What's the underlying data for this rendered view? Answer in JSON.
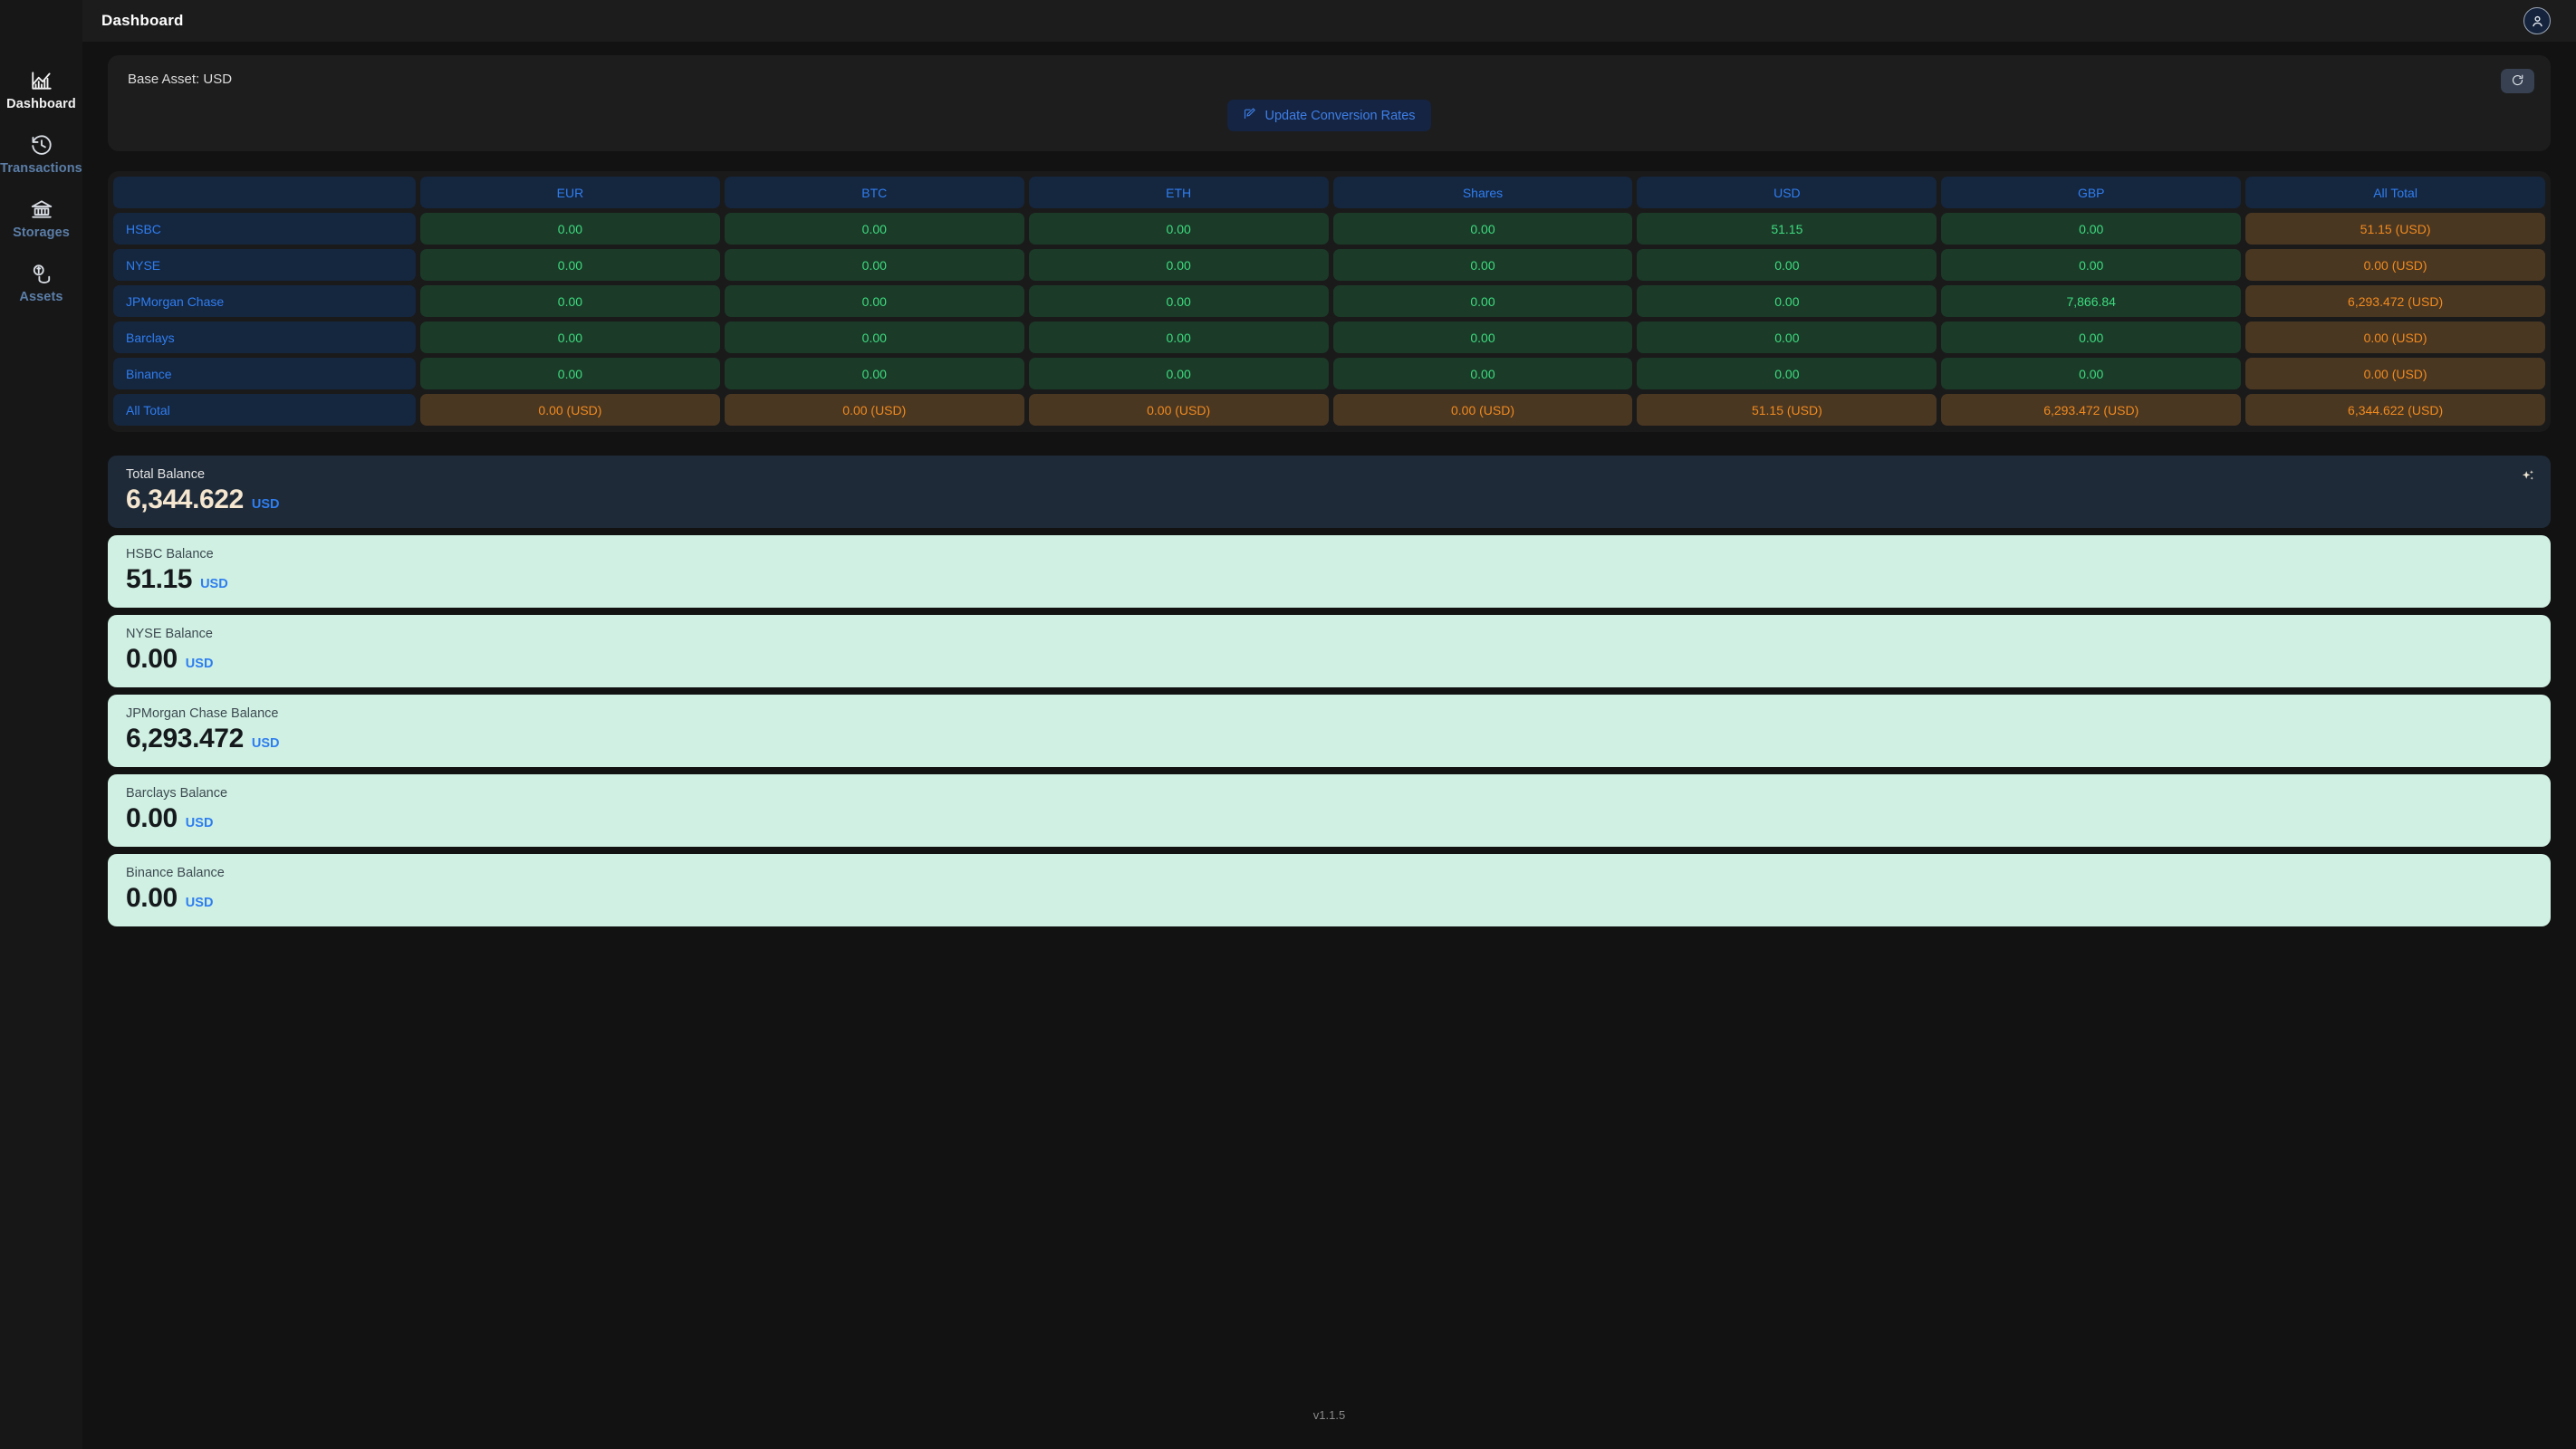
{
  "topbar": {
    "title": "Dashboard",
    "avatar_icon": "user-avatar-icon"
  },
  "sidebar": {
    "items": [
      {
        "label": "Dashboard",
        "icon": "area-chart-icon",
        "active": true
      },
      {
        "label": "Transactions",
        "icon": "clock-history-icon",
        "active": false
      },
      {
        "label": "Storages",
        "icon": "bank-icon",
        "active": false
      },
      {
        "label": "Assets",
        "icon": "coins-icon",
        "active": false
      }
    ]
  },
  "base_asset_panel": {
    "label": "Base Asset: USD",
    "update_button_label": "Update Conversion Rates",
    "update_button_icon": "edit-pencil-icon",
    "refresh_button_icon": "refresh-icon"
  },
  "matrix": {
    "corner_label": "",
    "columns": [
      "EUR",
      "BTC",
      "ETH",
      "Shares",
      "USD",
      "GBP",
      "All Total"
    ],
    "rows": [
      {
        "label": "HSBC",
        "values": [
          "0.00",
          "0.00",
          "0.00",
          "0.00",
          "51.15",
          "0.00"
        ],
        "total": "51.15 (USD)"
      },
      {
        "label": "NYSE",
        "values": [
          "0.00",
          "0.00",
          "0.00",
          "0.00",
          "0.00",
          "0.00"
        ],
        "total": "0.00 (USD)"
      },
      {
        "label": "JPMorgan Chase",
        "values": [
          "0.00",
          "0.00",
          "0.00",
          "0.00",
          "0.00",
          "7,866.84"
        ],
        "total": "6,293.472 (USD)"
      },
      {
        "label": "Barclays",
        "values": [
          "0.00",
          "0.00",
          "0.00",
          "0.00",
          "0.00",
          "0.00"
        ],
        "total": "0.00 (USD)"
      },
      {
        "label": "Binance",
        "values": [
          "0.00",
          "0.00",
          "0.00",
          "0.00",
          "0.00",
          "0.00"
        ],
        "total": "0.00 (USD)"
      }
    ],
    "total_row": {
      "label": "All Total",
      "values": [
        "0.00 (USD)",
        "0.00 (USD)",
        "0.00 (USD)",
        "0.00 (USD)",
        "51.15 (USD)",
        "6,293.472 (USD)"
      ],
      "total": "6,344.622 (USD)"
    },
    "colors": {
      "header_bg": "#15263f",
      "header_text": "#2f7ef0",
      "value_bg": "#1b3a28",
      "value_text": "#3ddc7f",
      "total_bg": "#4a3722",
      "total_text": "#f08a1e"
    }
  },
  "cards": [
    {
      "title": "Total Balance",
      "value": "6,344.622",
      "unit": "USD",
      "style": "total",
      "icon": "sparkle-icon"
    },
    {
      "title": "HSBC Balance",
      "value": "51.15",
      "unit": "USD",
      "style": "mint"
    },
    {
      "title": "NYSE Balance",
      "value": "0.00",
      "unit": "USD",
      "style": "mint"
    },
    {
      "title": "JPMorgan Chase Balance",
      "value": "6,293.472",
      "unit": "USD",
      "style": "mint"
    },
    {
      "title": "Barclays Balance",
      "value": "0.00",
      "unit": "USD",
      "style": "mint"
    },
    {
      "title": "Binance Balance",
      "value": "0.00",
      "unit": "USD",
      "style": "mint"
    }
  ],
  "footer": {
    "version": "v1.1.5"
  }
}
